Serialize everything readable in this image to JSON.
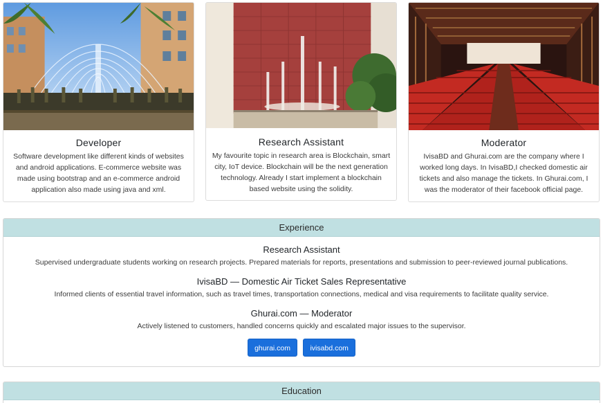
{
  "cards": [
    {
      "title": "Developer",
      "text": "Software development like different kinds of websites and android applications. E-commerce website was made using bootstrap and an e-commerce android application also made using java and xml.",
      "image": "fountain-courtyard-photo"
    },
    {
      "title": "Research Assistant",
      "text": "My favourite topic in research area is Blockchain, smart city, IoT device. Blockchain will be the next generation technology. Already I start implement a blockchain based website using the solidity.",
      "image": "red-wall-fountain-photo"
    },
    {
      "title": "Moderator",
      "text": "IvisaBD and Ghurai.com are the company where I worked long days. In IvisaBD,I checked domestic air tickets and also manage the tickets. In Ghurai.com, I was the moderator of their facebook official page.",
      "image": "auditorium-red-seats-photo"
    }
  ],
  "experience": {
    "header": "Experience",
    "items": [
      {
        "title": "Research Assistant",
        "desc": "Supervised undergraduate students working on research projects. Prepared materials for reports, presentations and submission to peer-reviewed journal publications."
      },
      {
        "title": "IvisaBD — Domestic Air Ticket Sales Representative",
        "desc": "Informed clients of essential travel information, such as travel times, transportation connections, medical and visa requirements to facilitate quality service."
      },
      {
        "title": "Ghurai.com — Moderator",
        "desc": "Actively listened to customers, handled concerns quickly and escalated major issues to the supervisor."
      }
    ],
    "buttons": [
      "ghurai.com",
      "ivisabd.com"
    ]
  },
  "education": {
    "header": "Education"
  },
  "colors": {
    "section_header_bg": "#c0e0e2",
    "button_bg": "#1a6fdc"
  }
}
